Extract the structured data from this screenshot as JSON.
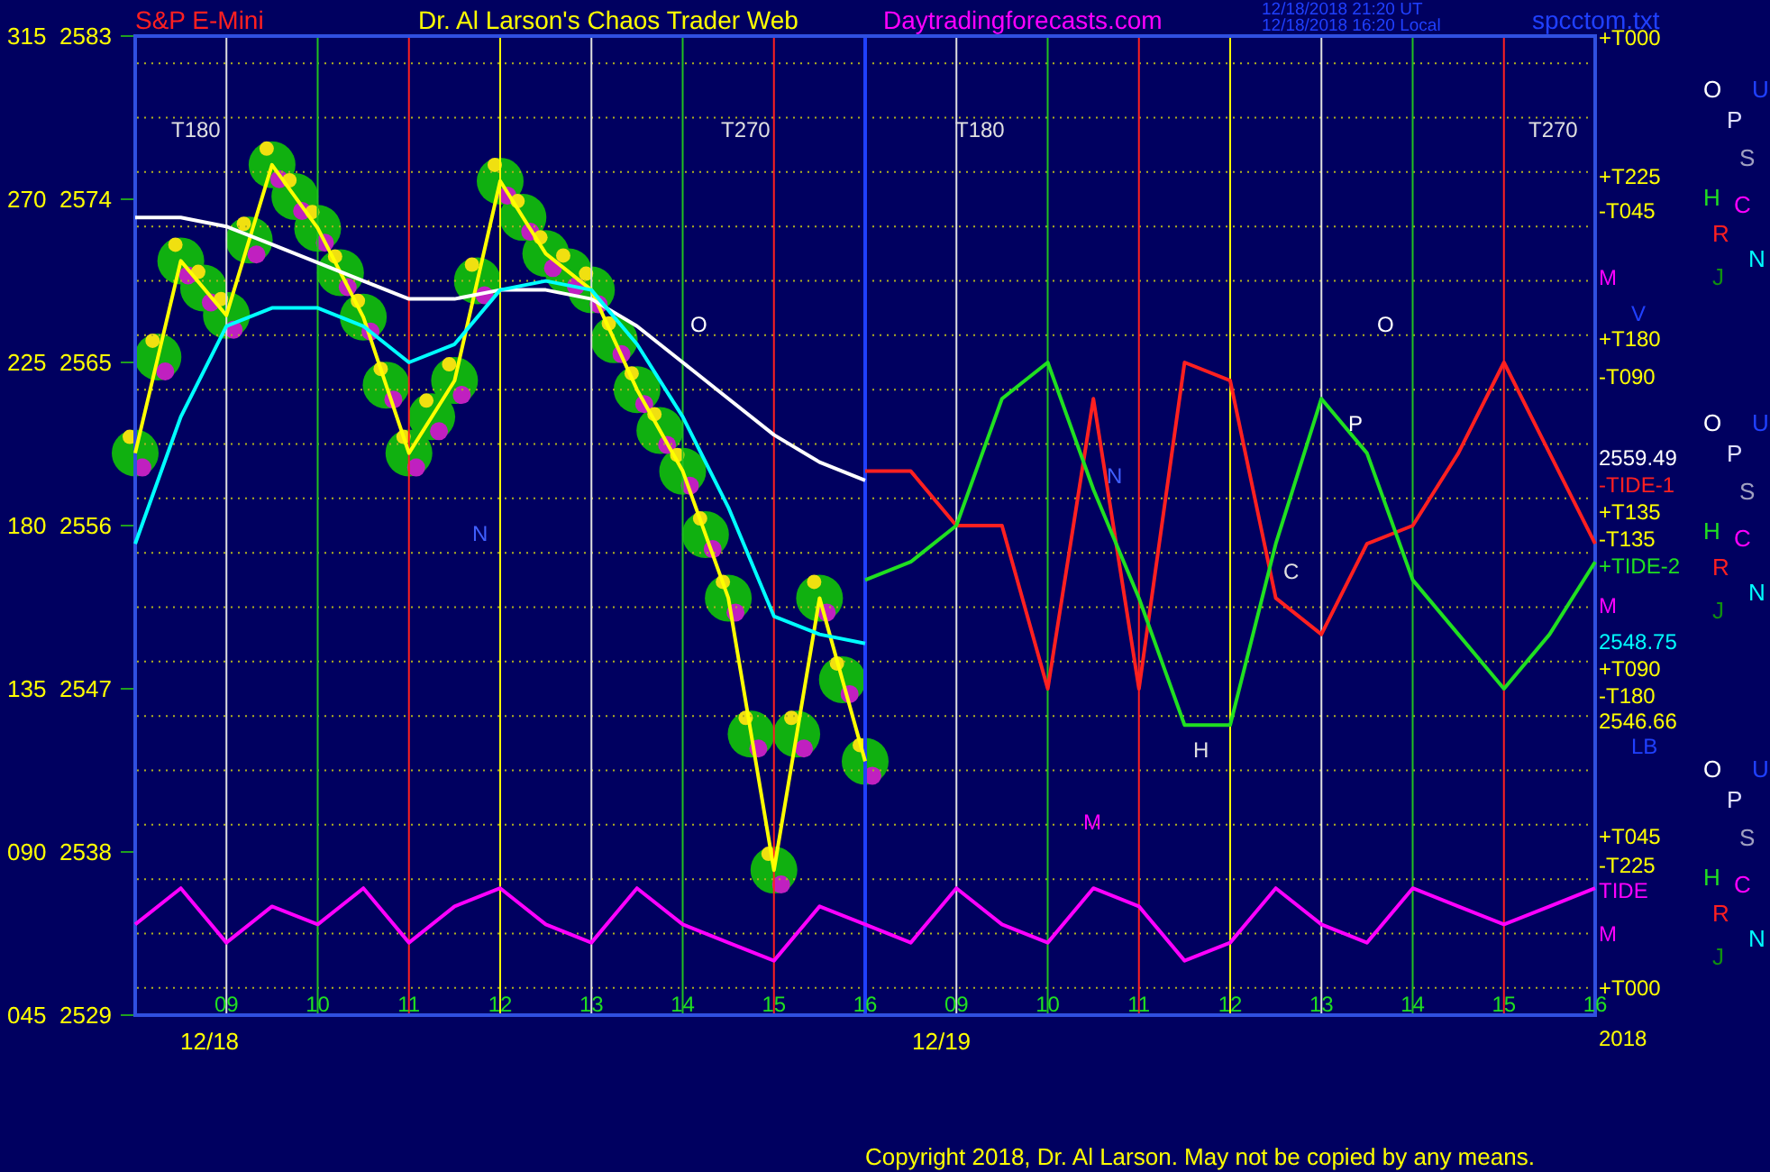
{
  "header": {
    "instrument": "S&P E-Mini",
    "title": "Dr. Al Larson's Chaos Trader Web",
    "site": "Daytradingforecasts.com",
    "time_ut": "12/18/2018 21:20 UT",
    "time_local": "12/18/2018 16:20 Local",
    "file": "spcctom.txt"
  },
  "axis_labels": [
    "315",
    "270",
    "225",
    "180",
    "135",
    "090",
    "045"
  ],
  "chart": {
    "chart_data": {
      "type": "line",
      "grid": true,
      "ylim": [
        2529,
        2583
      ],
      "xlim": [
        8,
        24
      ],
      "yticks": [
        {
          "value": 2583,
          "label": "2583"
        },
        {
          "value": 2574,
          "label": "2574"
        },
        {
          "value": 2565,
          "label": "2565"
        },
        {
          "value": 2556,
          "label": "2556"
        },
        {
          "value": 2547,
          "label": "2547"
        },
        {
          "value": 2538,
          "label": "2538"
        },
        {
          "value": 2529,
          "label": "2529"
        }
      ],
      "xticks": [
        {
          "value": 9,
          "label": "09"
        },
        {
          "value": 10,
          "label": "10"
        },
        {
          "value": 11,
          "label": "11"
        },
        {
          "value": 12,
          "label": "12"
        },
        {
          "value": 13,
          "label": "13"
        },
        {
          "value": 14,
          "label": "14"
        },
        {
          "value": 15,
          "label": "15"
        },
        {
          "value": 16,
          "label": "16"
        }
      ],
      "x": [
        8,
        8.5,
        9,
        9.5,
        10,
        10.5,
        11,
        11.5,
        12,
        12.5,
        13,
        13.5,
        14,
        14.5,
        15,
        15.5,
        16,
        16.5,
        17,
        17.5,
        18,
        18.5,
        19,
        19.5,
        20,
        20.5,
        21,
        21.5,
        22,
        22.5,
        23,
        23.5,
        24
      ],
      "series": [
        {
          "color": "#ffff00",
          "values": [
            2560,
            2570.6,
            2567.6,
            2575.9,
            2572.4,
            2567.5,
            2560,
            2564,
            2575,
            2571,
            2569,
            2563.5,
            2559,
            2552,
            2537,
            2552,
            2543,
            null,
            null,
            null,
            null,
            null,
            null,
            null,
            null,
            null,
            null,
            null,
            null,
            null,
            null,
            null,
            null
          ]
        },
        {
          "color": "#ffffff",
          "values": [
            2573,
            2573,
            2572.5,
            2571.5,
            2570.5,
            2569.5,
            2568.5,
            2568.5,
            2569,
            2569,
            2568.5,
            2567,
            2565,
            2563,
            2561,
            2559.5,
            2558.5,
            null,
            null,
            null,
            null,
            null,
            null,
            null,
            null,
            null,
            null,
            null,
            null,
            null,
            null,
            null,
            null
          ]
        },
        {
          "color": "#00ffff",
          "values": [
            2555,
            2562,
            2567,
            2568,
            2568,
            2567,
            2565,
            2566,
            2569,
            2569.5,
            2569,
            2566,
            2562,
            2557,
            2551,
            2550,
            2549.5,
            null,
            null,
            null,
            null,
            null,
            null,
            null,
            null,
            null,
            null,
            null,
            null,
            null,
            null,
            null,
            null
          ]
        },
        {
          "color": "#ff2020",
          "values": [
            null,
            null,
            null,
            null,
            null,
            null,
            null,
            null,
            null,
            null,
            null,
            null,
            null,
            null,
            null,
            null,
            2559,
            2559,
            2556,
            2556,
            2547,
            2563,
            2547,
            2565,
            2564,
            2552,
            2550,
            2555,
            2556,
            2560,
            2565,
            2560,
            2555
          ]
        },
        {
          "color": "#20e020",
          "values": [
            null,
            null,
            null,
            null,
            null,
            null,
            null,
            null,
            null,
            null,
            null,
            null,
            null,
            null,
            null,
            null,
            2553,
            2554,
            2556,
            2563,
            2565,
            2558,
            2552,
            2545,
            2545,
            2555,
            2563,
            2560,
            2553,
            2550,
            2547,
            2550,
            2554
          ]
        },
        {
          "color": "#ff00ff",
          "values": [
            2534,
            2536,
            2533,
            2535,
            2534,
            2536,
            2533,
            2535,
            2536,
            2534,
            2533,
            2536,
            2534,
            2533,
            2532,
            2535,
            2534,
            2533,
            2536,
            2534,
            2533,
            2536,
            2535,
            2532,
            2533,
            2536,
            2534,
            2533,
            2536,
            2535,
            2534,
            2535,
            2536
          ]
        }
      ]
    }
  },
  "next_day_hours": [
    "09",
    "10",
    "11",
    "12",
    "13",
    "14",
    "15",
    "16"
  ],
  "date_labels": [
    "12/18",
    "12/19"
  ],
  "chart_labels": [
    {
      "text": "T180",
      "color": "#e0e0e0"
    },
    {
      "text": "T270",
      "color": "#e0e0e0"
    },
    {
      "text": "T180",
      "color": "#e0e0e0"
    },
    {
      "text": "T270",
      "color": "#e0e0e0"
    },
    {
      "text": "N",
      "color": "#4060ff"
    },
    {
      "text": "O",
      "color": "#ffffff"
    },
    {
      "text": "O",
      "color": "#ffffff"
    },
    {
      "text": "P",
      "color": "#ffffff"
    },
    {
      "text": "N",
      "color": "#4060ff"
    },
    {
      "text": "C",
      "color": "#e0e0e0"
    },
    {
      "text": "H",
      "color": "#e0e0e0"
    },
    {
      "text": "M",
      "color": "#ff00ff"
    }
  ],
  "right_labels": [
    {
      "text": "+T000",
      "kind": "level",
      "color": "#ffff00"
    },
    {
      "text": "+T225",
      "kind": "level",
      "color": "#ffff00"
    },
    {
      "text": "-T045",
      "kind": "level",
      "color": "#ffff00"
    },
    {
      "text": "M",
      "kind": "level",
      "color": "#ff00ff"
    },
    {
      "text": "V",
      "kind": "marker",
      "color": "#2040ff"
    },
    {
      "text": "+T180",
      "kind": "level",
      "color": "#ffff00"
    },
    {
      "text": "-T090",
      "kind": "level",
      "color": "#ffff00"
    },
    {
      "text": "2559.49",
      "kind": "level",
      "color": "#ffffff"
    },
    {
      "text": "-TIDE-1",
      "kind": "level",
      "color": "#ff2020"
    },
    {
      "text": "+T135",
      "kind": "level",
      "color": "#ffff00"
    },
    {
      "text": "-T135",
      "kind": "level",
      "color": "#ffff00"
    },
    {
      "text": "+TIDE-2",
      "kind": "level",
      "color": "#20e020"
    },
    {
      "text": "M",
      "kind": "level",
      "color": "#ff00ff"
    },
    {
      "text": "2548.75",
      "kind": "level",
      "color": "#00ffff"
    },
    {
      "text": "+T090",
      "kind": "level",
      "color": "#ffff00"
    },
    {
      "text": "-T180",
      "kind": "level",
      "color": "#ffff00"
    },
    {
      "text": "2546.66",
      "kind": "level",
      "color": "#ffff00"
    },
    {
      "text": "LB",
      "kind": "marker",
      "color": "#2040ff"
    },
    {
      "text": "+T045",
      "kind": "level",
      "color": "#ffff00"
    },
    {
      "text": "-T225",
      "kind": "level",
      "color": "#ffff00"
    },
    {
      "text": "TIDE",
      "kind": "level",
      "color": "#ff00ff"
    },
    {
      "text": "M",
      "kind": "level",
      "color": "#ff00ff"
    },
    {
      "text": "+T000",
      "kind": "level",
      "color": "#ffff00"
    },
    {
      "text": "2018",
      "kind": "level",
      "color": "#ffff00"
    }
  ],
  "letter_groups": [
    {
      "letters": [
        {
          "text": "O",
          "color": "#ffffff"
        },
        {
          "text": "U",
          "color": "#2040ff"
        },
        {
          "text": "P",
          "color": "#e0e0ff"
        },
        {
          "text": "S",
          "color": "#a0a0c0"
        },
        {
          "text": "H",
          "color": "#20e020"
        },
        {
          "text": "C",
          "color": "#ff00ff"
        },
        {
          "text": "R",
          "color": "#ff2020"
        },
        {
          "text": "N",
          "color": "#00ffff"
        },
        {
          "text": "J",
          "color": "#109010"
        }
      ]
    },
    {
      "letters": [
        {
          "text": "O",
          "color": "#ffffff"
        },
        {
          "text": "U",
          "color": "#2040ff"
        },
        {
          "text": "P",
          "color": "#e0e0ff"
        },
        {
          "text": "S",
          "color": "#a0a0c0"
        },
        {
          "text": "H",
          "color": "#20e020"
        },
        {
          "text": "C",
          "color": "#ff00ff"
        },
        {
          "text": "R",
          "color": "#ff2020"
        },
        {
          "text": "N",
          "color": "#00ffff"
        },
        {
          "text": "J",
          "color": "#109010"
        }
      ]
    },
    {
      "letters": [
        {
          "text": "O",
          "color": "#ffffff"
        },
        {
          "text": "U",
          "color": "#2040ff"
        },
        {
          "text": "P",
          "color": "#e0e0ff"
        },
        {
          "text": "S",
          "color": "#a0a0c0"
        },
        {
          "text": "H",
          "color": "#20e020"
        },
        {
          "text": "C",
          "color": "#ff00ff"
        },
        {
          "text": "R",
          "color": "#ff2020"
        },
        {
          "text": "N",
          "color": "#00ffff"
        },
        {
          "text": "J",
          "color": "#109010"
        }
      ]
    }
  ],
  "copyright": "Copyright 2018, Dr. Al Larson. May not be copied by any means."
}
